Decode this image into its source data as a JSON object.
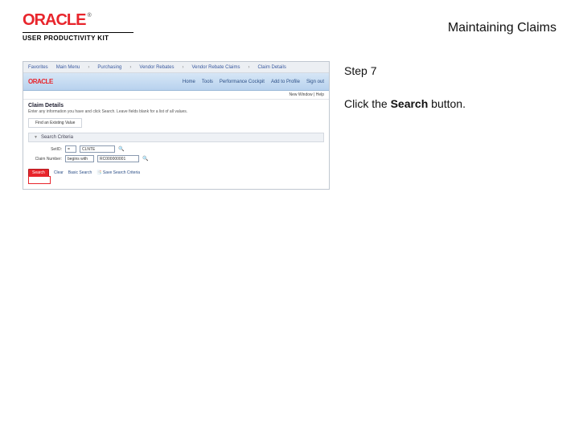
{
  "header": {
    "logo_text": "ORACLE",
    "logo_tm": "®",
    "subtitle": "USER PRODUCTIVITY KIT",
    "page_title": "Maintaining Claims"
  },
  "instruction": {
    "step_label": "Step 7",
    "direction_prefix": "Click the ",
    "direction_bold": "Search",
    "direction_suffix": " button."
  },
  "shot": {
    "breadcrumb": {
      "a": "Favorites",
      "b": "Main Menu",
      "c": "Purchasing",
      "d": "Vendor Rebates",
      "e": "Vendor Rebate Claims",
      "f": "Claim Details"
    },
    "tabs": {
      "a": "Home",
      "b": "Tools",
      "c": "Performance Cockpit",
      "d": "Add to Profile",
      "e": "Sign out"
    },
    "subbar": "New Window | Help",
    "section_title": "Claim Details",
    "section_sub": "Enter any information you have and click Search. Leave fields blank for a list of all values.",
    "tab_label": "Find an Existing Value",
    "collapse_label": "Search Criteria",
    "fields": {
      "setid_label": "SetID:",
      "setid_op": "=",
      "setid_val": "CLNTE",
      "claim_label": "Claim Number:",
      "claim_op": "begins with",
      "claim_val": "RC000000001"
    },
    "buttons": {
      "search": "Search",
      "clear": "Clear",
      "basic": "Basic Search",
      "save": "Save Search Criteria"
    }
  }
}
